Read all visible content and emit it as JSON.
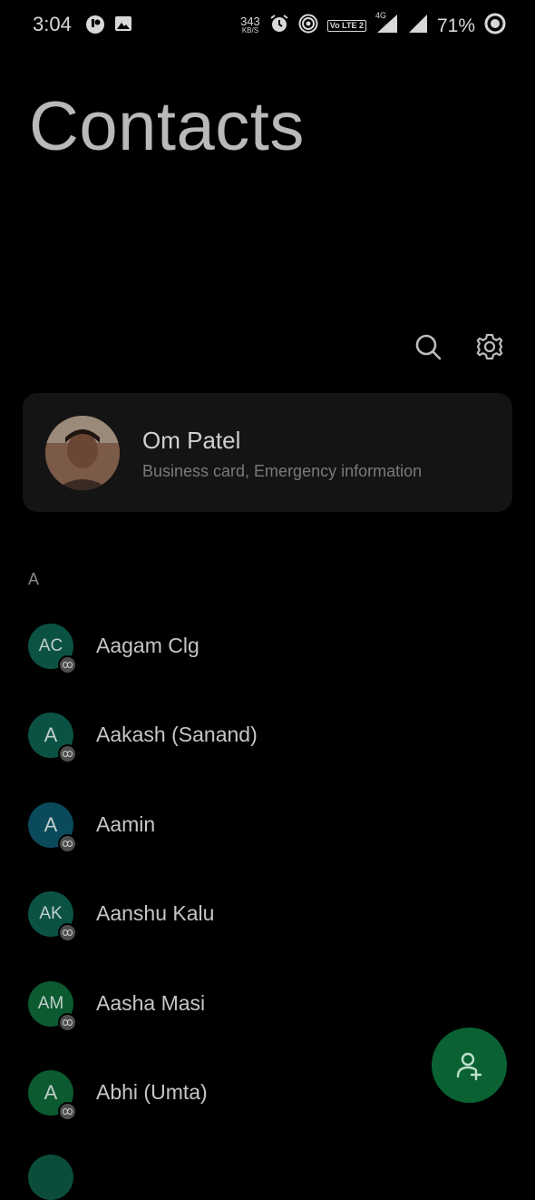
{
  "status_bar": {
    "time": "3:04",
    "net_speed_value": "343",
    "net_speed_unit": "KB/S",
    "volte_label": "Vo LTE 2",
    "network_type": "4G",
    "battery_percent": "71%"
  },
  "header": {
    "title": "Contacts"
  },
  "toolbar": {
    "search_icon": "search-icon",
    "settings_icon": "gear-icon"
  },
  "profile": {
    "name": "Om Patel",
    "subtitle": "Business card, Emergency information"
  },
  "section": {
    "letter": "A"
  },
  "contacts": [
    {
      "initials": "AC",
      "name": "Aagam Clg",
      "color": "#0b5245"
    },
    {
      "initials": "A",
      "name": "Aakash (Sanand)",
      "color": "#0b5245"
    },
    {
      "initials": "A",
      "name": "Aamin",
      "color": "#0b4a5a"
    },
    {
      "initials": "AK",
      "name": "Aanshu Kalu",
      "color": "#0b5245"
    },
    {
      "initials": "AM",
      "name": "Aasha Masi",
      "color": "#0c5a2f"
    },
    {
      "initials": "A",
      "name": "Abhi (Umta)",
      "color": "#0c5a2f"
    }
  ],
  "fab": {
    "icon": "add-contact-icon",
    "color": "#0a6233"
  }
}
